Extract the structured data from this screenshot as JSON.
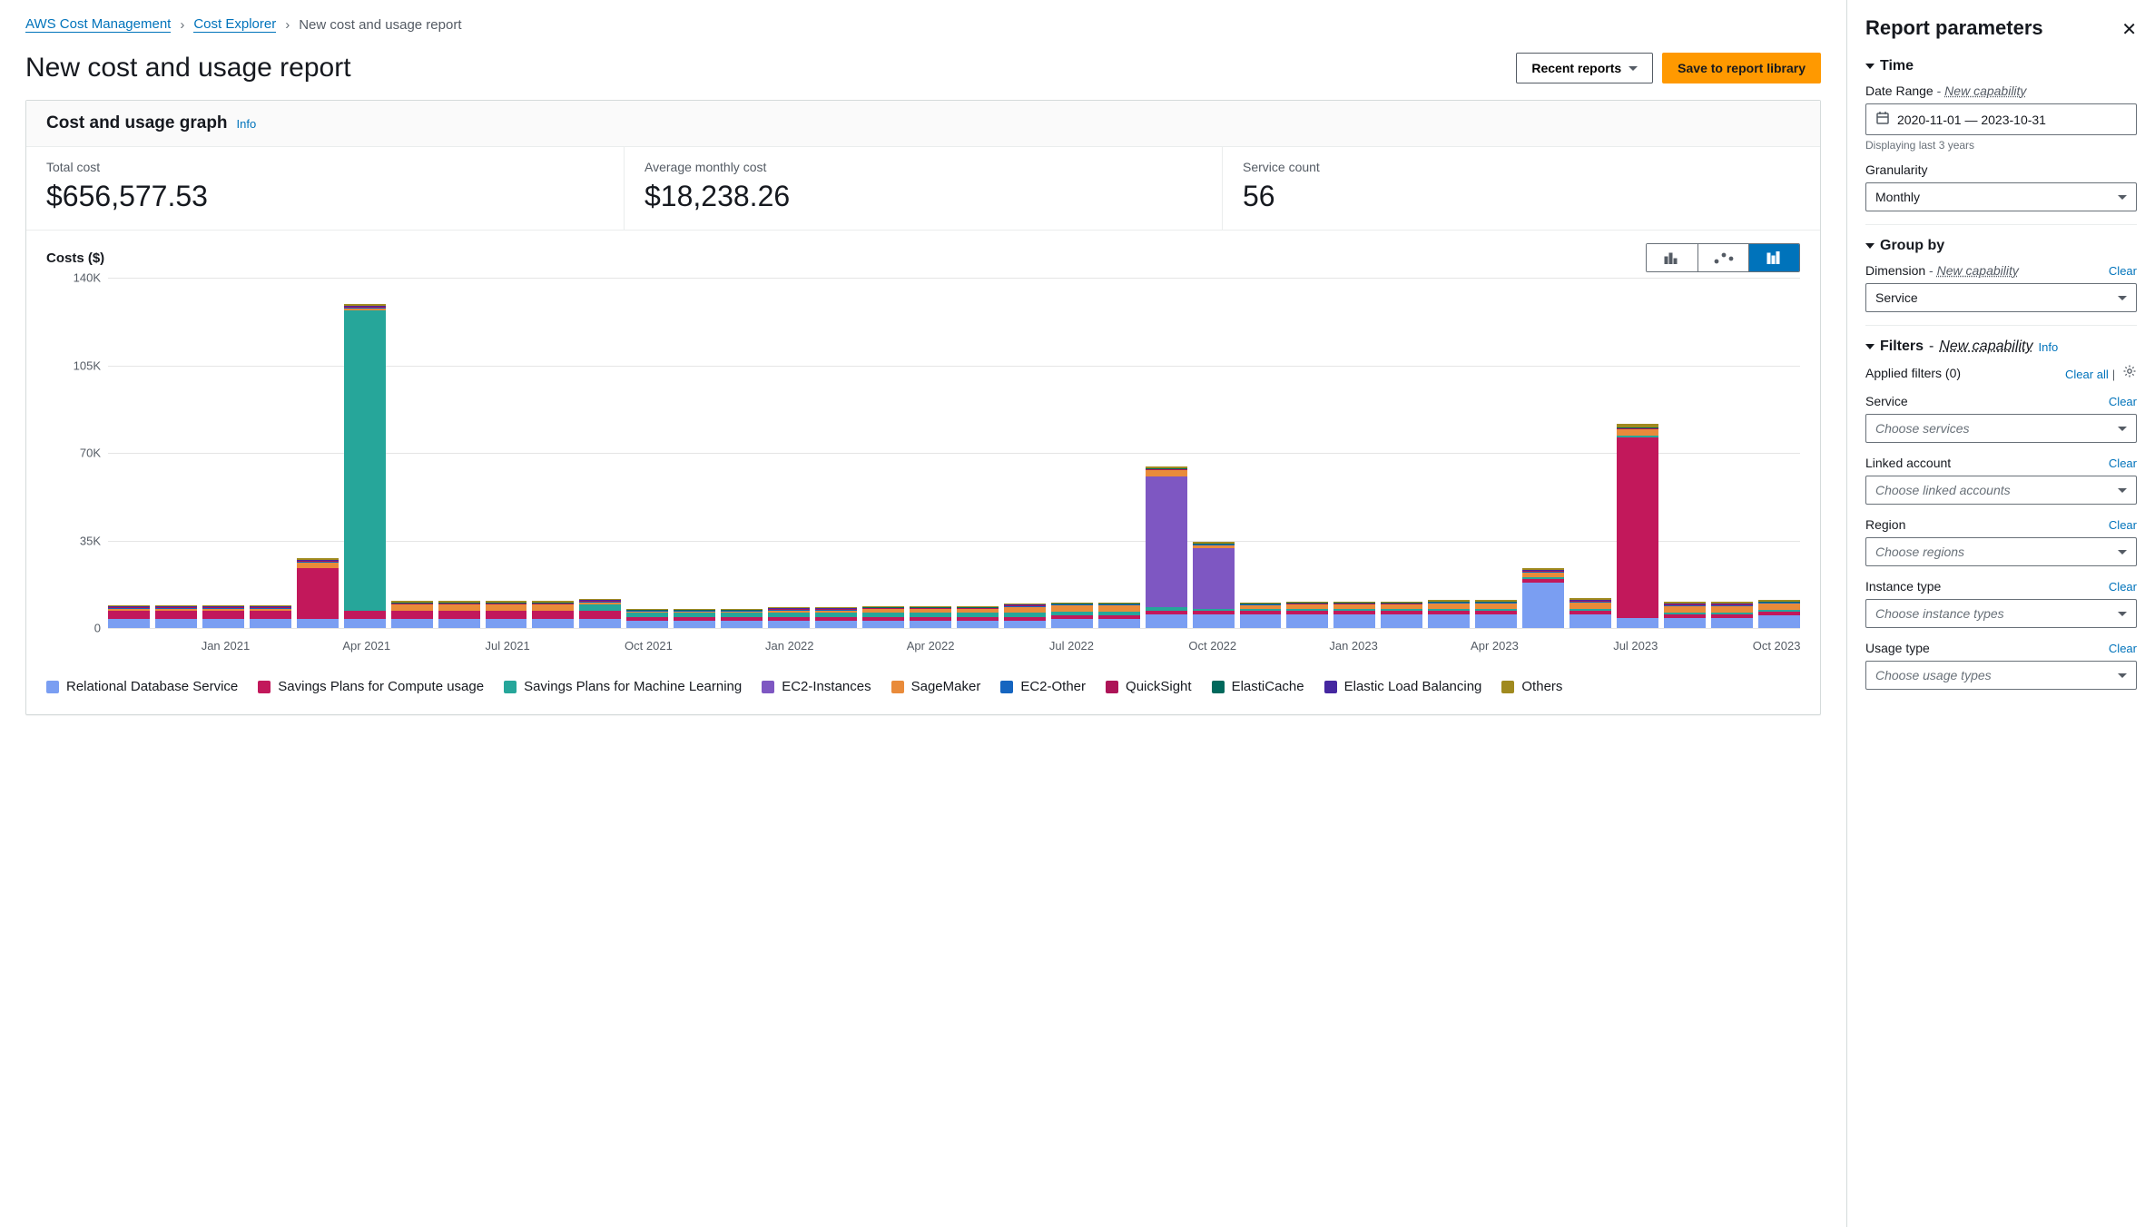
{
  "breadcrumbs": {
    "items": [
      {
        "label": "AWS Cost Management",
        "link": true
      },
      {
        "label": "Cost Explorer",
        "link": true
      },
      {
        "label": "New cost and usage report",
        "link": false
      }
    ]
  },
  "header": {
    "title": "New cost and usage report",
    "recent_reports": "Recent reports",
    "save_library": "Save to report library"
  },
  "panel": {
    "title": "Cost and usage graph",
    "info": "Info"
  },
  "metrics": {
    "total_label": "Total cost",
    "total_value": "$656,577.53",
    "avg_label": "Average monthly cost",
    "avg_value": "$18,238.26",
    "count_label": "Service count",
    "count_value": "56"
  },
  "chart_title": "Costs ($)",
  "legend_labels": {
    "rds": "Relational Database Service",
    "sp_compute": "Savings Plans for Compute usage",
    "sp_ml": "Savings Plans for Machine Learning",
    "ec2_inst": "EC2-Instances",
    "sagemaker": "SageMaker",
    "ec2_other": "EC2-Other",
    "quicksight": "QuickSight",
    "elasticache": "ElastiCache",
    "elb": "Elastic Load Balancing",
    "others": "Others"
  },
  "colors": {
    "rds": "#7a9ef2",
    "sp_compute": "#c2185b",
    "sp_ml": "#26a69a",
    "ec2_inst": "#7e57c2",
    "sagemaker": "#e98b3a",
    "ec2_other": "#1565c0",
    "quicksight": "#ad1457",
    "elasticache": "#00695c",
    "elb": "#4527a0",
    "others": "#a08a1f"
  },
  "side": {
    "title": "Report parameters",
    "time": "Time",
    "date_range_label": "Date Range",
    "new_capability": "New capability",
    "date_range_value": "2020-11-01 — 2023-10-31",
    "date_range_helper": "Displaying last 3 years",
    "granularity_label": "Granularity",
    "granularity_value": "Monthly",
    "groupby": "Group by",
    "dimension_label": "Dimension",
    "dimension_value": "Service",
    "clear": "Clear",
    "filters": "Filters",
    "info": "Info",
    "applied_filters": "Applied filters (0)",
    "clear_all": "Clear all",
    "filter_fields": [
      {
        "label": "Service",
        "placeholder": "Choose services"
      },
      {
        "label": "Linked account",
        "placeholder": "Choose linked accounts"
      },
      {
        "label": "Region",
        "placeholder": "Choose regions"
      },
      {
        "label": "Instance type",
        "placeholder": "Choose instance types"
      },
      {
        "label": "Usage type",
        "placeholder": "Choose usage types"
      }
    ]
  },
  "chart_data": {
    "type": "bar",
    "stacked": true,
    "ylabel": "Costs ($)",
    "ylim": [
      0,
      140000
    ],
    "yticks": [
      0,
      35000,
      70000,
      105000,
      140000
    ],
    "ytick_labels": [
      "0",
      "35K",
      "70K",
      "105K",
      "140K"
    ],
    "categories": [
      "Nov 2020",
      "Dec 2020",
      "Jan 2021",
      "Feb 2021",
      "Mar 2021",
      "Apr 2021",
      "May 2021",
      "Jun 2021",
      "Jul 2021",
      "Aug 2021",
      "Sep 2021",
      "Oct 2021",
      "Nov 2021",
      "Dec 2021",
      "Jan 2022",
      "Feb 2022",
      "Mar 2022",
      "Apr 2022",
      "May 2022",
      "Jun 2022",
      "Jul 2022",
      "Aug 2022",
      "Sep 2022",
      "Oct 2022",
      "Nov 2022",
      "Dec 2022",
      "Jan 2023",
      "Feb 2023",
      "Mar 2023",
      "Apr 2023",
      "May 2023",
      "Jun 2023",
      "Jul 2023",
      "Aug 2023",
      "Sep 2023",
      "Oct 2023"
    ],
    "x_tick_labels": [
      "Jan 2021",
      "Apr 2021",
      "Jul 2021",
      "Oct 2021",
      "Jan 2022",
      "Apr 2022",
      "Jul 2022",
      "Oct 2022",
      "Jan 2023",
      "Apr 2023",
      "Jul 2023",
      "Oct 2023"
    ],
    "x_tick_positions": [
      2,
      5,
      8,
      11,
      14,
      17,
      20,
      23,
      26,
      29,
      32,
      35
    ],
    "series": [
      {
        "name": "Relational Database Service",
        "color": "rds",
        "values": [
          3800,
          3800,
          3800,
          3800,
          3800,
          3800,
          3800,
          3800,
          3800,
          3800,
          3800,
          3000,
          3000,
          3000,
          3000,
          3000,
          3000,
          3000,
          3000,
          3000,
          3500,
          3500,
          5500,
          5500,
          5500,
          5500,
          5500,
          5500,
          5500,
          5500,
          18000,
          5500,
          4000,
          4000,
          4000,
          5000
        ]
      },
      {
        "name": "Savings Plans for Compute usage",
        "color": "sp_compute",
        "values": [
          3000,
          3000,
          3000,
          3000,
          20000,
          3000,
          3000,
          3000,
          3000,
          3000,
          3000,
          1500,
          1500,
          1500,
          1500,
          1500,
          1500,
          1500,
          1500,
          1500,
          1500,
          1500,
          1500,
          1500,
          1500,
          1500,
          1500,
          1500,
          1500,
          1500,
          1500,
          1500,
          72000,
          1500,
          1500,
          1500
        ]
      },
      {
        "name": "Savings Plans for Machine Learning",
        "color": "sp_ml",
        "values": [
          0,
          0,
          0,
          0,
          0,
          120000,
          0,
          0,
          0,
          0,
          2500,
          1500,
          1500,
          1500,
          1500,
          1500,
          1500,
          1500,
          1500,
          1500,
          1500,
          1500,
          1500,
          800,
          800,
          800,
          800,
          800,
          800,
          800,
          800,
          800,
          800,
          800,
          800,
          800
        ]
      },
      {
        "name": "EC2-Instances",
        "color": "ec2_inst",
        "values": [
          0,
          0,
          0,
          0,
          0,
          0,
          0,
          0,
          0,
          0,
          0,
          0,
          0,
          0,
          0,
          0,
          0,
          0,
          0,
          0,
          0,
          0,
          52000,
          24000,
          0,
          0,
          0,
          0,
          0,
          0,
          0,
          0,
          0,
          0,
          0,
          0
        ]
      },
      {
        "name": "SageMaker",
        "color": "sagemaker",
        "values": [
          1000,
          1000,
          1000,
          1000,
          2500,
          1000,
          2500,
          2500,
          2500,
          2500,
          1000,
          500,
          500,
          500,
          1000,
          1000,
          1500,
          1500,
          1500,
          2500,
          2500,
          2500,
          2500,
          1200,
          1200,
          1500,
          1500,
          1500,
          2000,
          2000,
          2000,
          2500,
          2500,
          2500,
          2500,
          2500
        ]
      },
      {
        "name": "EC2-Other",
        "color": "ec2_other",
        "values": [
          300,
          300,
          300,
          300,
          300,
          300,
          300,
          300,
          300,
          300,
          300,
          300,
          300,
          300,
          300,
          300,
          300,
          300,
          300,
          300,
          300,
          300,
          300,
          300,
          300,
          300,
          300,
          300,
          300,
          300,
          300,
          300,
          300,
          300,
          300,
          300
        ]
      },
      {
        "name": "QuickSight",
        "color": "quicksight",
        "values": [
          200,
          200,
          200,
          200,
          200,
          200,
          200,
          200,
          200,
          200,
          200,
          200,
          200,
          200,
          200,
          200,
          200,
          200,
          200,
          200,
          200,
          200,
          200,
          200,
          200,
          200,
          200,
          200,
          200,
          200,
          200,
          200,
          200,
          200,
          200,
          200
        ]
      },
      {
        "name": "ElastiCache",
        "color": "elasticache",
        "values": [
          200,
          200,
          200,
          200,
          200,
          200,
          200,
          200,
          200,
          200,
          200,
          200,
          200,
          200,
          200,
          200,
          200,
          200,
          200,
          200,
          200,
          200,
          200,
          200,
          200,
          200,
          200,
          200,
          200,
          200,
          200,
          200,
          200,
          200,
          200,
          200
        ]
      },
      {
        "name": "Elastic Load Balancing",
        "color": "elb",
        "values": [
          200,
          200,
          200,
          200,
          200,
          200,
          200,
          200,
          200,
          200,
          200,
          200,
          200,
          200,
          200,
          200,
          200,
          200,
          200,
          200,
          200,
          200,
          200,
          200,
          200,
          200,
          200,
          200,
          200,
          200,
          200,
          200,
          200,
          200,
          200,
          200
        ]
      },
      {
        "name": "Others",
        "color": "others",
        "values": [
          400,
          400,
          400,
          400,
          700,
          700,
          700,
          700,
          700,
          700,
          400,
          400,
          400,
          400,
          400,
          400,
          400,
          400,
          400,
          400,
          400,
          400,
          700,
          700,
          400,
          400,
          400,
          400,
          400,
          400,
          700,
          700,
          1500,
          700,
          700,
          700
        ]
      }
    ]
  }
}
